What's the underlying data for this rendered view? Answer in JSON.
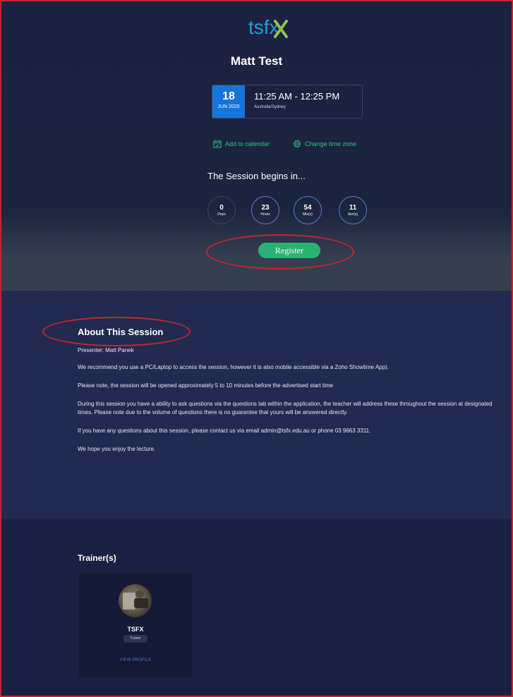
{
  "brand": {
    "logo_text": "tsfx",
    "accent": "#28b372",
    "primary": "#1774d8"
  },
  "session": {
    "title": "Matt Test",
    "date_day": "18",
    "date_month": "JUN 2020",
    "time_range": "11:25 AM - 12:25 PM",
    "timezone": "Australia/Sydney"
  },
  "actions": {
    "add_to_calendar": "Add to calendar",
    "change_time_zone": "Change time zone",
    "register": "Register"
  },
  "countdown": {
    "heading": "The Session begins in...",
    "units": [
      {
        "value": "0",
        "label": "Days"
      },
      {
        "value": "23",
        "label": "Hours"
      },
      {
        "value": "54",
        "label": "Min(s)"
      },
      {
        "value": "11",
        "label": "Sec(s)"
      }
    ]
  },
  "about": {
    "title": "About This Session",
    "presenter": "Presenter: Matt Panek",
    "paragraphs": [
      "We recommend you use a PC/Laptop to access the session, however it is also mobile accessible via a Zoho Showtime App).",
      "Please note, the session will be opened approximately 5 to 10 minutes before the advertised start time",
      "During this session you have a ability to ask questions via the questions tab within the application, the teacher will address these throughout the session at designated times.  Please note due to the volume of questions there is no guarantee that yours will be answered directly.",
      "If you have any questions about this session, please contact us via email admin@tsfx.edu.au or phone 03 9663 3311.",
      "We hope you enjoy the lecture."
    ]
  },
  "trainers": {
    "title": "Trainer(s)",
    "items": [
      {
        "name": "TSFX",
        "role": "Trainer",
        "view_profile": "VIEW PROFILE"
      }
    ]
  }
}
